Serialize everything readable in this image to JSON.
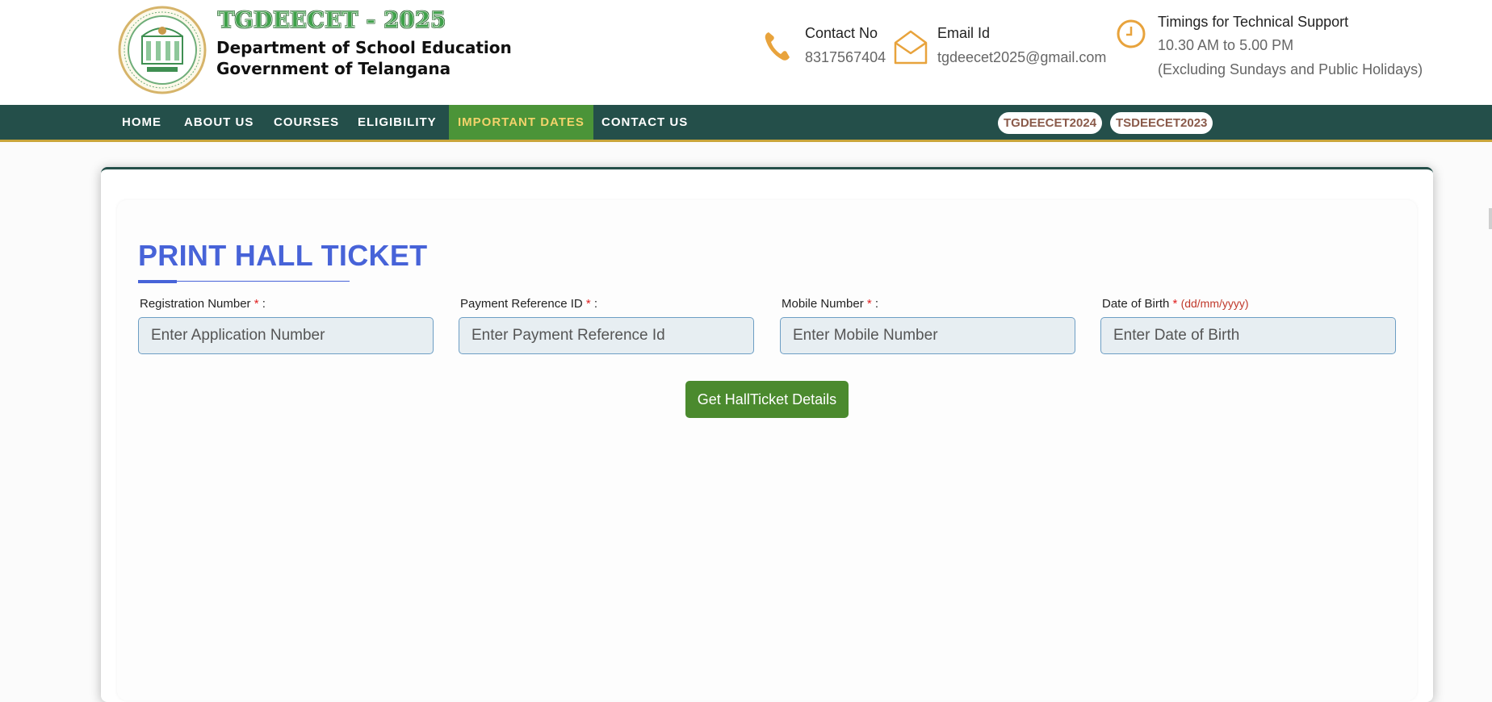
{
  "header": {
    "brand_title": "TGDEECET - 2025",
    "brand_line1": "Department of School Education",
    "brand_line2": "Government of Telangana",
    "contact": {
      "label": "Contact No",
      "value": "8317567404"
    },
    "email": {
      "label": "Email Id",
      "value": "tgdeecet2025@gmail.com"
    },
    "timings": {
      "label": "Timings for Technical Support",
      "line1": "10.30 AM to 5.00 PM",
      "line2": "(Excluding Sundays and Public Holidays)"
    },
    "accent_color": "#e8a33c"
  },
  "nav": {
    "items": [
      {
        "label": "HOME"
      },
      {
        "label": "ABOUT US"
      },
      {
        "label": "COURSES"
      },
      {
        "label": "ELIGIBILITY"
      },
      {
        "label": "IMPORTANT DATES",
        "active": true
      },
      {
        "label": "CONTACT US"
      }
    ],
    "pills": [
      "TGDEECET2024",
      "TSDEECET2023"
    ],
    "bg_color": "#244f4a",
    "active_color": "#4b9438"
  },
  "form": {
    "title": "PRINT HALL TICKET",
    "fields": [
      {
        "label": "Registration Number",
        "required": "*",
        "suffix": " :",
        "placeholder": "Enter Application Number",
        "value": ""
      },
      {
        "label": "Payment Reference ID",
        "required": "*",
        "suffix": " :",
        "placeholder": "Enter Payment Reference Id",
        "value": ""
      },
      {
        "label": "Mobile Number",
        "required": "*",
        "suffix": " :",
        "placeholder": "Enter Mobile Number",
        "value": ""
      },
      {
        "label": "Date of Birth",
        "required": "*",
        "hint": "(dd/mm/yyyy)",
        "placeholder": "Enter Date of Birth",
        "value": ""
      }
    ],
    "submit_label": "Get HallTicket Details",
    "title_color": "#4763d8",
    "button_color": "#4b8a2e"
  }
}
